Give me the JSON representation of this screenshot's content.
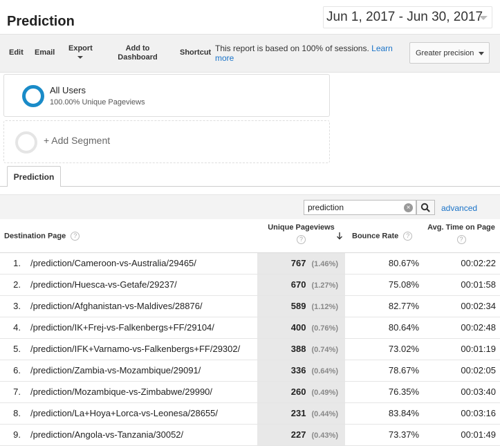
{
  "header": {
    "title": "Prediction",
    "date_range": "Jun 1, 2017 - Jun 30, 2017"
  },
  "toolbar": {
    "edit": "Edit",
    "email": "Email",
    "export": "Export",
    "add_to_dashboard": "Add to Dashboard",
    "shortcut": "Shortcut",
    "note": "This report is based on 100% of sessions.",
    "learn_more": "Learn more",
    "precision": "Greater precision"
  },
  "segments": {
    "active_name": "All Users",
    "active_sub": "100.00% Unique Pageviews",
    "add_label": "+ Add Segment"
  },
  "tabs": {
    "active": "Prediction"
  },
  "filter": {
    "query": "prediction",
    "advanced": "advanced"
  },
  "table": {
    "headers": {
      "page": "Destination Page",
      "upv": "Unique Pageviews",
      "bounce": "Bounce Rate",
      "time": "Avg. Time on Page"
    },
    "rows": [
      {
        "num": "1.",
        "page": "/prediction/Cameroon-vs-Australia/29465/",
        "upv": "767",
        "pct": "(1.46%)",
        "bounce": "80.67%",
        "time": "00:02:22"
      },
      {
        "num": "2.",
        "page": "/prediction/Huesca-vs-Getafe/29237/",
        "upv": "670",
        "pct": "(1.27%)",
        "bounce": "75.08%",
        "time": "00:01:58"
      },
      {
        "num": "3.",
        "page": "/prediction/Afghanistan-vs-Maldives/28876/",
        "upv": "589",
        "pct": "(1.12%)",
        "bounce": "82.77%",
        "time": "00:02:34"
      },
      {
        "num": "4.",
        "page": "/prediction/IK+Frej-vs-Falkenbergs+FF/29104/",
        "upv": "400",
        "pct": "(0.76%)",
        "bounce": "80.64%",
        "time": "00:02:48"
      },
      {
        "num": "5.",
        "page": "/prediction/IFK+Varnamo-vs-Falkenbergs+FF/29302/",
        "upv": "388",
        "pct": "(0.74%)",
        "bounce": "73.02%",
        "time": "00:01:19"
      },
      {
        "num": "6.",
        "page": "/prediction/Zambia-vs-Mozambique/29091/",
        "upv": "336",
        "pct": "(0.64%)",
        "bounce": "78.67%",
        "time": "00:02:05"
      },
      {
        "num": "7.",
        "page": "/prediction/Mozambique-vs-Zimbabwe/29990/",
        "upv": "260",
        "pct": "(0.49%)",
        "bounce": "76.35%",
        "time": "00:03:40"
      },
      {
        "num": "8.",
        "page": "/prediction/La+Hoya+Lorca-vs-Leonesa/28655/",
        "upv": "231",
        "pct": "(0.44%)",
        "bounce": "83.84%",
        "time": "00:03:16"
      },
      {
        "num": "9.",
        "page": "/prediction/Angola-vs-Tanzania/30052/",
        "upv": "227",
        "pct": "(0.43%)",
        "bounce": "73.37%",
        "time": "00:01:49"
      }
    ]
  }
}
